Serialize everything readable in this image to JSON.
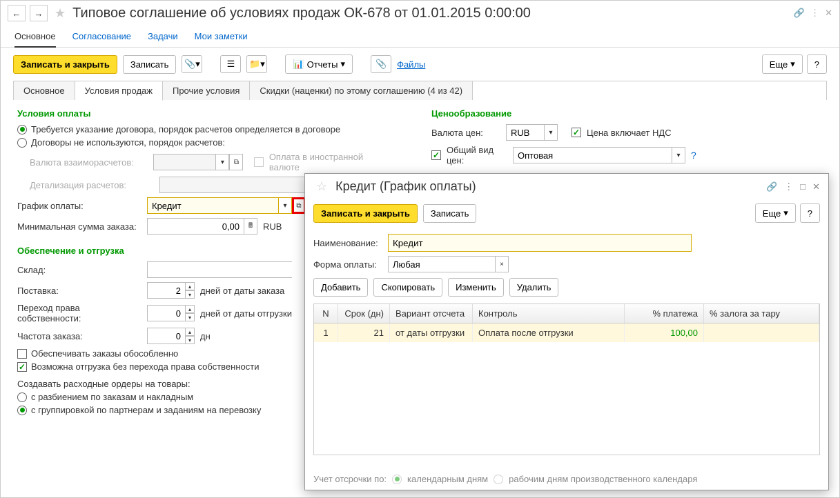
{
  "header": {
    "title": "Типовое соглашение об условиях продаж ОК-678 от 01.01.2015 0:00:00"
  },
  "navTabs": {
    "main": "Основное",
    "approval": "Согласование",
    "tasks": "Задачи",
    "notes": "Мои заметки"
  },
  "toolbar": {
    "saveClose": "Записать и закрыть",
    "save": "Записать",
    "reports": "Отчеты",
    "files": "Файлы",
    "more": "Еще",
    "help": "?"
  },
  "formTabs": {
    "main": "Основное",
    "salesTerms": "Условия продаж",
    "otherTerms": "Прочие условия",
    "discounts": "Скидки (наценки) по этому соглашению (4 из 42)"
  },
  "payment": {
    "sectionTitle": "Условия оплаты",
    "radio1": "Требуется указание договора, порядок расчетов определяется в договоре",
    "radio2": "Договоры не используются, порядок расчетов:",
    "currencyLabel": "Валюта взаиморасчетов:",
    "foreignPay": "Оплата в иностранной валюте",
    "detailLabel": "Детализация расчетов:",
    "scheduleLabel": "График оплаты:",
    "scheduleValue": "Кредит",
    "minOrderLabel": "Минимальная сумма заказа:",
    "minOrderValue": "0,00",
    "minOrderCurrency": "RUB"
  },
  "pricing": {
    "sectionTitle": "Ценообразование",
    "currencyLabel": "Валюта цен:",
    "currencyValue": "RUB",
    "vatIncluded": "Цена включает НДС",
    "priceTypeLabel": "Общий вид цен:",
    "priceTypeValue": "Оптовая"
  },
  "shipping": {
    "sectionTitle": "Обеспечение и отгрузка",
    "warehouseLabel": "Склад:",
    "deliveryLabel": "Поставка:",
    "deliveryValue": "2",
    "deliveryUnit": "дней от даты заказа",
    "ownershipLabel": "Переход права собственности:",
    "ownershipValue": "0",
    "ownershipUnit": "дней от даты отгрузки",
    "frequencyLabel": "Частота заказа:",
    "frequencyValue": "0",
    "frequencyUnit": "дн",
    "separateOrders": "Обеспечивать заказы обособленно",
    "shipWithoutOwnership": "Возможна отгрузка без перехода права собственности",
    "createOrdersLabel": "Создавать расходные ордеры на товары:",
    "createOrders1": "с разбиением по заказам и накладным",
    "createOrders2": "с группировкой по партнерам и заданиям на перевозку"
  },
  "dialog": {
    "title": "Кредит (График оплаты)",
    "saveClose": "Записать и закрыть",
    "save": "Записать",
    "more": "Еще",
    "help": "?",
    "nameLabel": "Наименование:",
    "nameValue": "Кредит",
    "payFormLabel": "Форма оплаты:",
    "payFormValue": "Любая",
    "add": "Добавить",
    "copy": "Скопировать",
    "edit": "Изменить",
    "delete": "Удалить",
    "cols": {
      "n": "N",
      "term": "Срок (дн)",
      "variant": "Вариант отсчета",
      "control": "Контроль",
      "pct": "% платежа",
      "deposit": "% залога за тару"
    },
    "row": {
      "n": "1",
      "term": "21",
      "variant": "от даты отгрузки",
      "control": "Оплата после отгрузки",
      "pct": "100,00",
      "deposit": ""
    },
    "footer": {
      "label": "Учет отсрочки по:",
      "opt1": "календарным дням",
      "opt2": "рабочим дням производственного календаря"
    }
  }
}
